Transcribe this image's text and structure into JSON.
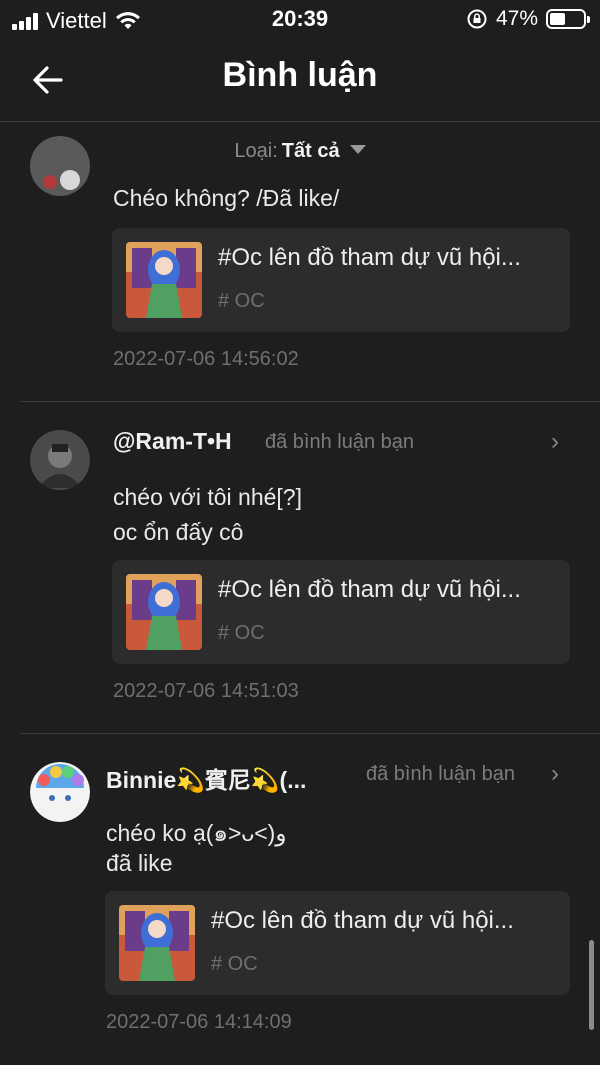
{
  "status_bar": {
    "carrier": "Viettel",
    "time": "20:39",
    "battery": "47%",
    "battery_level": 0.47
  },
  "header": {
    "title": "Bình luận"
  },
  "filter": {
    "label": "Loại:",
    "value": "Tất cả"
  },
  "comments": [
    {
      "body": [
        "Chéo không? /Đã like/"
      ],
      "post": {
        "title": "#Oc lên đồ tham dự vũ hội...",
        "tag": "# OC"
      },
      "timestamp": "2022-07-06 14:56:02"
    },
    {
      "user": "@Ram-T•H",
      "action": "đã bình luận bạn",
      "body": [
        "chéo với tôi nhé[?]",
        "oc ổn đấy cô"
      ],
      "post": {
        "title": "#Oc lên đồ tham dự vũ hội...",
        "tag": "# OC"
      },
      "timestamp": "2022-07-06 14:51:03"
    },
    {
      "user": "Binnie💫賓尼💫(...",
      "action": "đã bình luận bạn",
      "body": [
        "chéo ko ạ(๑˃ᴗ˂)ﻭ",
        "đã like"
      ],
      "post": {
        "title": "#Oc lên đồ tham dự vũ hội...",
        "tag": "# OC"
      },
      "timestamp": "2022-07-06 14:14:09"
    }
  ],
  "icons": {
    "back": "arrow-left-icon",
    "chevron": "chevron-right-icon",
    "caret": "caret-down-icon"
  },
  "colors": {
    "background": "#1e1e1e",
    "card": "#2c2c2c",
    "muted_text": "#6f6f6f"
  }
}
